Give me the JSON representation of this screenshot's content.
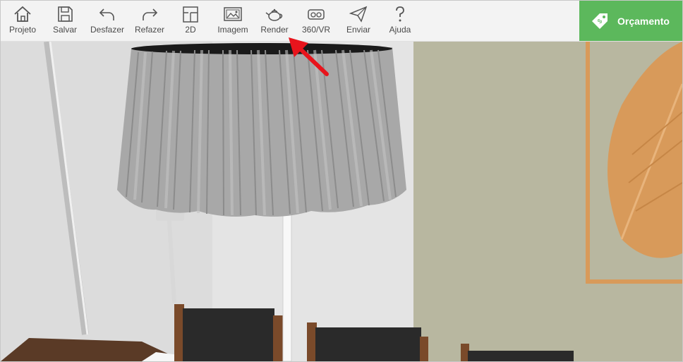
{
  "toolbar": {
    "items": [
      {
        "label": "Projeto",
        "icon": "home-icon"
      },
      {
        "label": "Salvar",
        "icon": "save-icon"
      },
      {
        "label": "Desfazer",
        "icon": "undo-icon"
      },
      {
        "label": "Refazer",
        "icon": "redo-icon"
      },
      {
        "label": "2D",
        "icon": "floorplan-icon"
      },
      {
        "label": "Imagem",
        "icon": "image-icon"
      },
      {
        "label": "Render",
        "icon": "teapot-icon"
      },
      {
        "label": "360/VR",
        "icon": "vr-headset-icon"
      },
      {
        "label": "Enviar",
        "icon": "send-icon"
      },
      {
        "label": "Ajuda",
        "icon": "question-icon"
      }
    ],
    "budget_label": "Orçamento",
    "budget_icon": "price-tag-icon"
  },
  "colors": {
    "toolbar_bg": "#f3f3f3",
    "budget_green": "#5cb85c",
    "arrow_red": "#e8141c",
    "wall_left": "#e6e6e6",
    "wall_right": "#b8b8a0",
    "frame_orange": "#d89a5a"
  },
  "scene": {
    "description_icon": "3d-viewport"
  }
}
